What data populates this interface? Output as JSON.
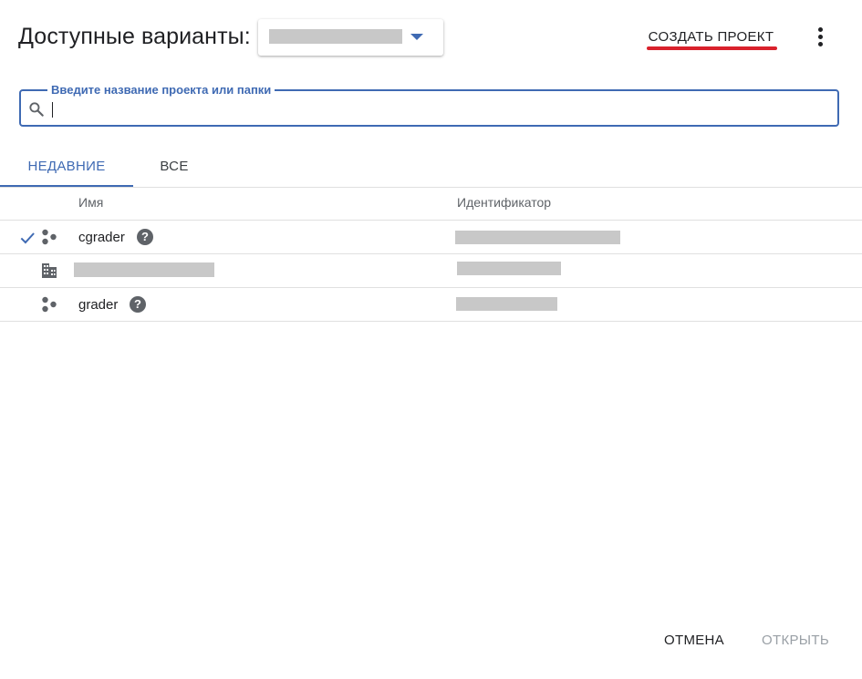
{
  "header": {
    "title": "Доступные варианты:",
    "org_selector": {
      "value": ""
    },
    "create_project_label": "СОЗДАТЬ ПРОЕКТ"
  },
  "search": {
    "label": "Введите название проекта или папки",
    "value": ""
  },
  "tabs": [
    {
      "label": "НЕДАВНИЕ",
      "active": true
    },
    {
      "label": "ВСЕ",
      "active": false
    }
  ],
  "table": {
    "columns": [
      "Имя",
      "Идентификатор"
    ],
    "rows": [
      {
        "selected": true,
        "type": "project",
        "name": "cgrader",
        "help": true,
        "id": ""
      },
      {
        "selected": false,
        "type": "organization",
        "name": "",
        "help": false,
        "id": ""
      },
      {
        "selected": false,
        "type": "project",
        "name": "grader",
        "help": true,
        "id": ""
      }
    ]
  },
  "footer": {
    "cancel_label": "ОТМЕНА",
    "open_label": "ОТКРЫТЬ"
  },
  "icons": {
    "help_glyph": "?"
  },
  "colors": {
    "accent": "#3f6ab3",
    "highlight_underline": "#d9212c",
    "disabled_text": "#9aa0a6",
    "redacted": "#c8c8c8"
  }
}
